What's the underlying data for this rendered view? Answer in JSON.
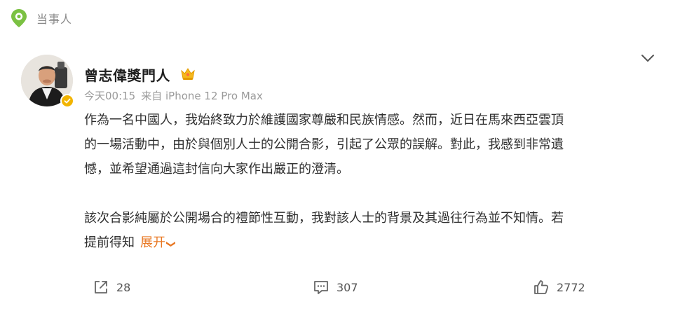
{
  "topbar": {
    "icon": "location-pin-icon",
    "label": "当事人"
  },
  "post": {
    "username": "曾志偉獎門人",
    "badge_icon": "vip-crown-icon",
    "verified_icon": "verified-icon",
    "timestamp": "今天00:15",
    "source": "来自 iPhone 12 Pro Max",
    "paragraph_1": [
      "作為一名中國人，我始終致力於維護國家尊嚴和民族情感。然而，近日在馬來西亞雲頂",
      "的一場活動中，由於與個別人士的公開合影，引起了公眾的誤解。對此，我感到非常遺",
      "憾，並希望通過這封信向大家作出嚴正的澄清。"
    ],
    "paragraph_2": [
      "該次合影純屬於公開場合的禮節性互動，我對該人士的背景及其過往行為並不知情。若",
      "提前得知"
    ],
    "expand_label": "展开",
    "expand_arrow": "❯"
  },
  "actions": {
    "repost_count": "28",
    "comment_count": "307",
    "like_count": "2772"
  },
  "colors": {
    "accent": "#e87722",
    "topbar_icon": "#7bc142",
    "verified": "#f2b400"
  }
}
